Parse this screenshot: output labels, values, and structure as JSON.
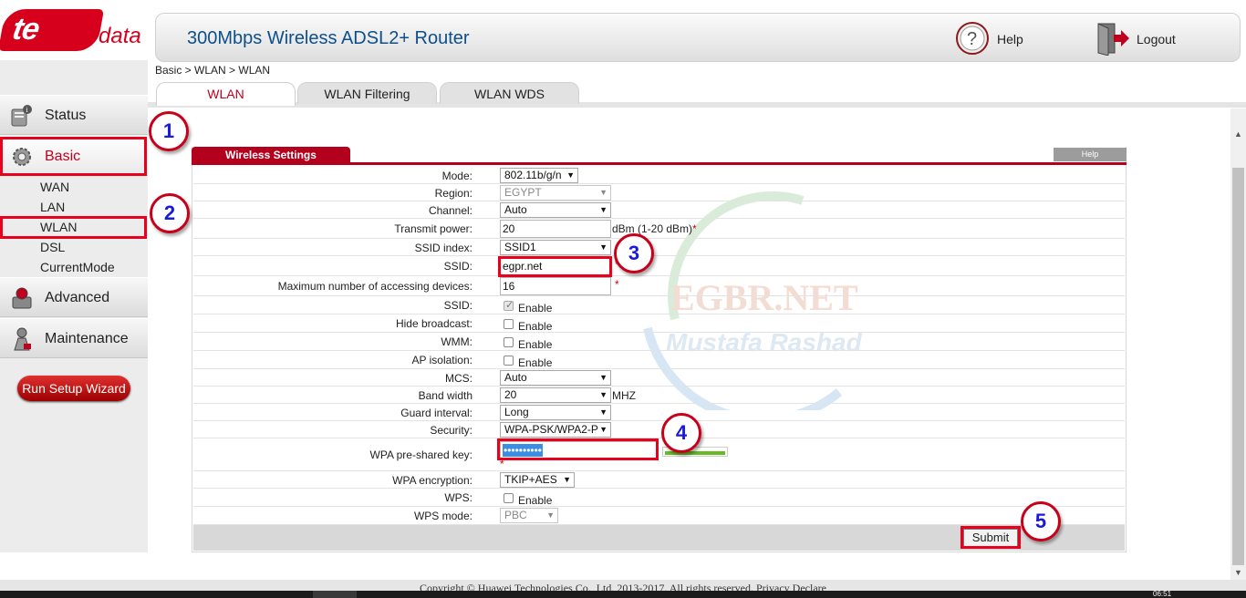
{
  "brand": {
    "logo_text": "te",
    "logo_suffix": "data"
  },
  "header": {
    "title": "300Mbps Wireless ADSL2+ Router",
    "help_label": "Help",
    "logout_label": "Logout"
  },
  "breadcrumb": "Basic > WLAN > WLAN",
  "sidebar": {
    "status": "Status",
    "basic": "Basic",
    "sub_items": [
      "WAN",
      "LAN",
      "WLAN",
      "DSL",
      "CurrentMode"
    ],
    "advanced": "Advanced",
    "maintenance": "Maintenance",
    "wizard": "Run Setup Wizard"
  },
  "tabs": [
    "WLAN",
    "WLAN Filtering",
    "WLAN WDS"
  ],
  "panel": {
    "title": "Wireless Settings",
    "help": "Help"
  },
  "form": {
    "mode": {
      "label": "Mode:",
      "value": "802.11b/g/n"
    },
    "region": {
      "label": "Region:",
      "value": "EGYPT"
    },
    "channel": {
      "label": "Channel:",
      "value": "Auto"
    },
    "transmit_power": {
      "label": "Transmit power:",
      "value": "20",
      "unit": "dBm (1-20 dBm)"
    },
    "ssid_index": {
      "label": "SSID index:",
      "value": "SSID1"
    },
    "ssid": {
      "label": "SSID:",
      "value": "egpr.net"
    },
    "max_devices": {
      "label": "Maximum number of accessing devices:",
      "value": "16"
    },
    "ssid_enable": {
      "label": "SSID:",
      "option": "Enable"
    },
    "hide_broadcast": {
      "label": "Hide broadcast:",
      "option": "Enable"
    },
    "wmm": {
      "label": "WMM:",
      "option": "Enable"
    },
    "ap_isolation": {
      "label": "AP isolation:",
      "option": "Enable"
    },
    "mcs": {
      "label": "MCS:",
      "value": "Auto"
    },
    "band_width": {
      "label": "Band width",
      "value": "20",
      "unit": "MHZ"
    },
    "guard_interval": {
      "label": "Guard interval:",
      "value": "Long"
    },
    "security": {
      "label": "Security:",
      "value": "WPA-PSK/WPA2-P"
    },
    "wpa_key": {
      "label": "WPA pre-shared key:",
      "value": "••••••••••"
    },
    "wpa_encryption": {
      "label": "WPA encryption:",
      "value": "TKIP+AES"
    },
    "wps": {
      "label": "WPS:",
      "option": "Enable"
    },
    "wps_mode": {
      "label": "WPS mode:",
      "value": "PBC"
    }
  },
  "required_mark": "*",
  "submit_label": "Submit",
  "callouts": [
    "1",
    "2",
    "3",
    "4",
    "5"
  ],
  "watermark": {
    "line1": "EGBR.NET",
    "line2": "Mustafa Rashad"
  },
  "footer": "Copyright © Huawei Technologies Co., Ltd. 2013-2017. All rights reserved.  Privacy Declare",
  "clock": "06:51",
  "colors": {
    "brand_red": "#d6001c",
    "panel_red": "#b3001d",
    "title_blue": "#0d4f8b",
    "callout_border": "#c8001a",
    "callout_digit": "#1a1adc"
  }
}
